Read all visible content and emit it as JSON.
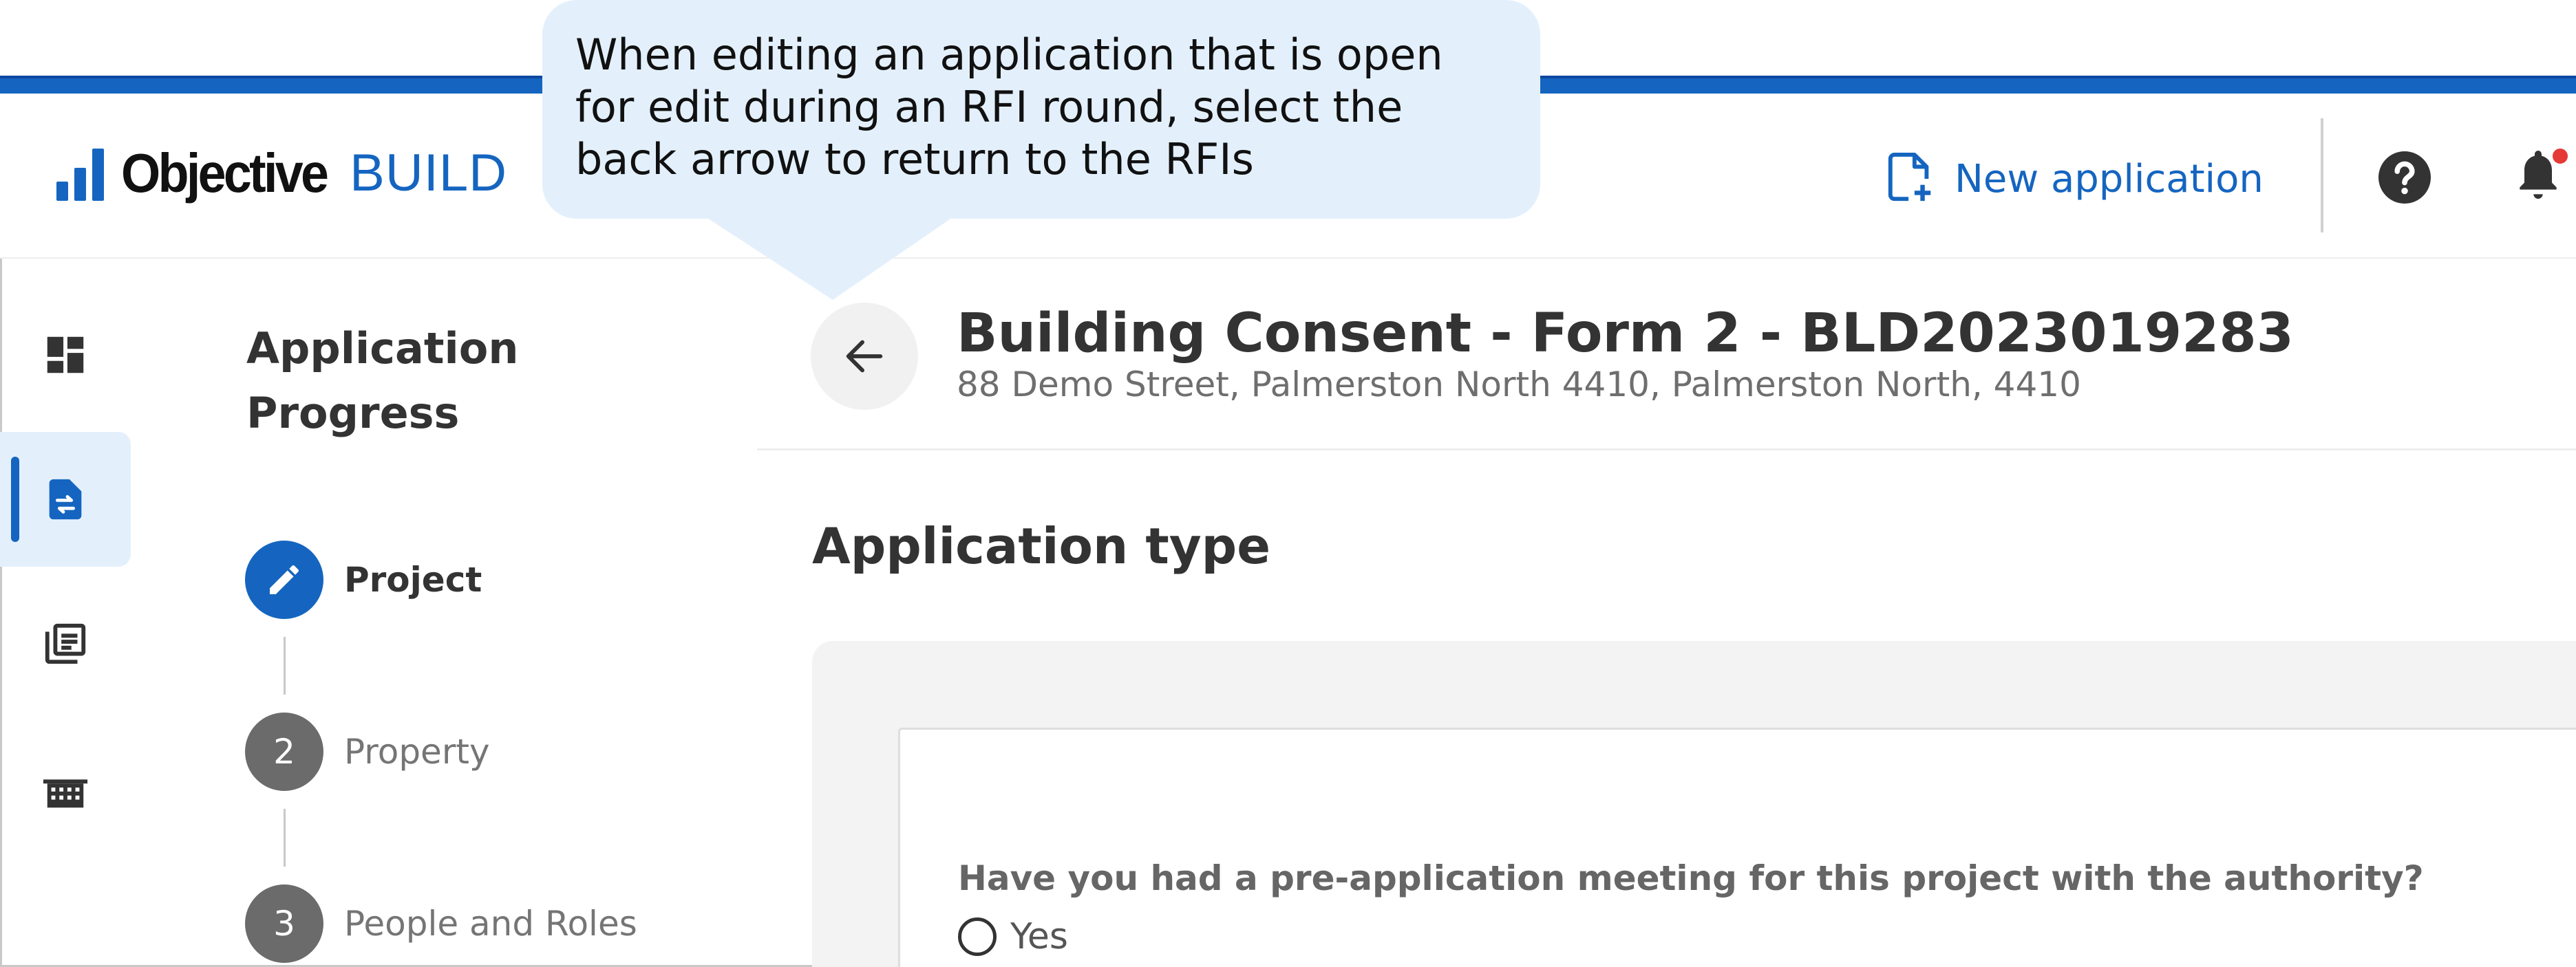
{
  "callout": {
    "text": "When editing an application that is open for edit during an RFI round, select the back arrow to return to the RFIs"
  },
  "header": {
    "logo_word": "Objective",
    "logo_product": "BUILD",
    "new_application_label": "New application",
    "notification_dot_color": "#e53935",
    "icons": [
      "new-document-icon",
      "help-icon",
      "bell-icon"
    ]
  },
  "sidebar": {
    "items": [
      {
        "name": "dashboard",
        "icon": "dashboard-icon",
        "active": false
      },
      {
        "name": "applications",
        "icon": "application-document-icon",
        "active": true
      },
      {
        "name": "library",
        "icon": "library-books-icon",
        "active": false
      },
      {
        "name": "buildings",
        "icon": "building-icon",
        "active": false
      }
    ]
  },
  "progress": {
    "title": "Application Progress",
    "steps": [
      {
        "label": "Project",
        "status": "current",
        "marker_icon": "pencil-icon"
      },
      {
        "label": "Property",
        "status": "todo",
        "number": "2"
      },
      {
        "label": "People and Roles",
        "status": "todo",
        "number": "3"
      }
    ]
  },
  "main": {
    "title": "Building Consent - Form 2 - BLD2023019283",
    "subtitle": "88 Demo Street, Palmerston North 4410, Palmerston North, 4410",
    "section_title": "Application type",
    "question": "Have you had a pre-application meeting for this project with the authority?",
    "options": [
      "Yes"
    ]
  },
  "colors": {
    "accent": "#1565c0",
    "callout_bg": "#e3f0fc",
    "step_todo": "#6b6b6b"
  }
}
